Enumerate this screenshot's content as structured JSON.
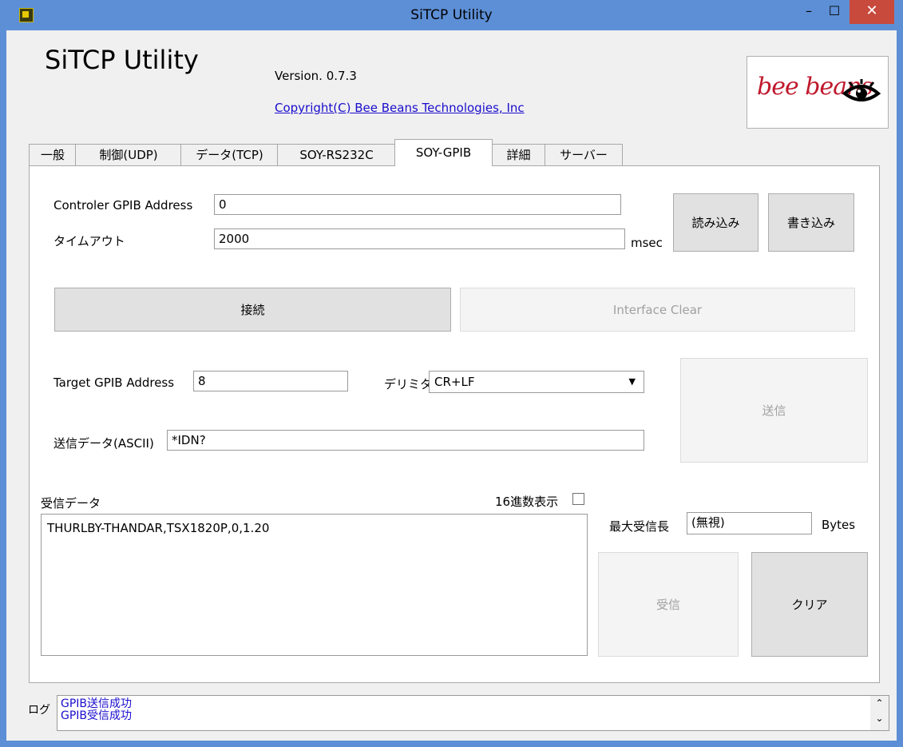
{
  "window": {
    "title": "SiTCP Utility",
    "minimize": "–",
    "maximize": "☐",
    "close": "✕"
  },
  "header": {
    "app_title": "SiTCP Utility",
    "version": "Version. 0.7.3",
    "copyright": "Copyright(C) Bee Beans Technologies, Inc",
    "logo_text": "bee beans"
  },
  "tabs": [
    {
      "label": "一般"
    },
    {
      "label": "制御(UDP)"
    },
    {
      "label": "データ(TCP)"
    },
    {
      "label": "SOY-RS232C"
    },
    {
      "label": "SOY-GPIB",
      "active": true
    },
    {
      "label": "詳細"
    },
    {
      "label": "サーバー"
    }
  ],
  "gpib": {
    "controller_address_label": "Controler GPIB Address",
    "controller_address_value": "0",
    "timeout_label": "タイムアウト",
    "timeout_value": "2000",
    "timeout_unit": "msec",
    "read_button": "読み込み",
    "write_button": "書き込み",
    "connect_button": "接続",
    "interface_clear_button": "Interface Clear",
    "target_address_label": "Target GPIB Address",
    "target_address_value": "8",
    "delimiter_label": "デリミタ",
    "delimiter_value": "CR+LF",
    "send_data_label": "送信データ(ASCII)",
    "send_data_value": "*IDN?",
    "send_button": "送信",
    "receive_data_label": "受信データ",
    "hex_display_label": "16進数表示",
    "hex_display_checked": false,
    "receive_data_value": "THURLBY-THANDAR,TSX1820P,0,1.20",
    "max_receive_label": "最大受信長",
    "max_receive_value": "(無視)",
    "max_receive_unit": "Bytes",
    "receive_button": "受信",
    "clear_button": "クリア"
  },
  "log": {
    "label": "ログ",
    "lines": [
      "GPIB送信成功",
      "GPIB受信成功"
    ]
  }
}
